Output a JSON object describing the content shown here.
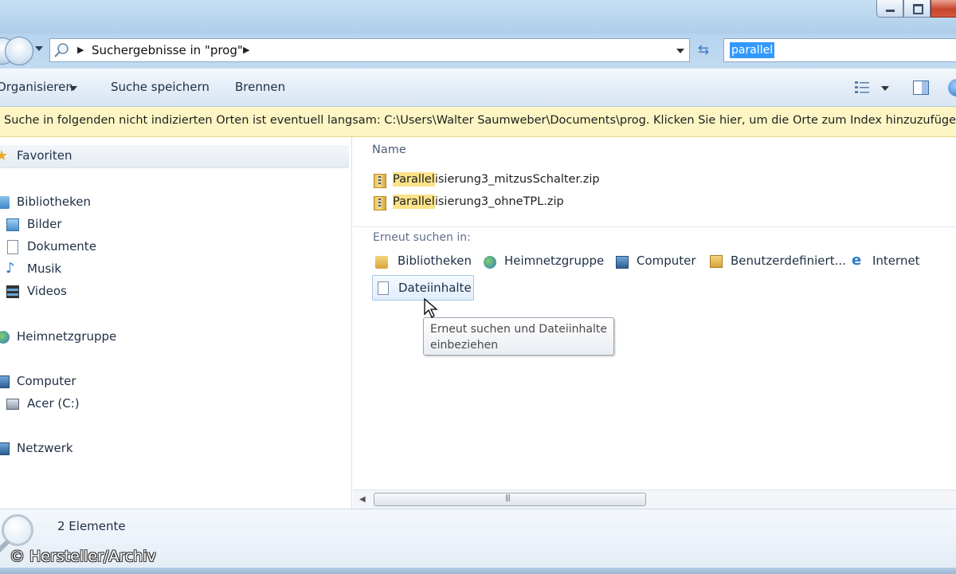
{
  "address": {
    "location": "Suchergebnisse in \"prog\""
  },
  "search": {
    "value": "parallel"
  },
  "toolbar": {
    "organize": "Organisieren",
    "save_search": "Suche speichern",
    "burn": "Brennen"
  },
  "infobar": {
    "text": "Suche in folgenden nicht indizierten Orten ist eventuell langsam: C:\\Users\\Walter Saumweber\\Documents\\prog. Klicken Sie hier, um die Orte zum Index hinzuzufügen..."
  },
  "navpane": {
    "favorites": "Favoriten",
    "libraries": "Bibliotheken",
    "library_items": [
      "Bilder",
      "Dokumente",
      "Musik",
      "Videos"
    ],
    "homegroup": "Heimnetzgruppe",
    "computer": "Computer",
    "drive": "Acer (C:)",
    "network": "Netzwerk"
  },
  "content": {
    "column_name": "Name",
    "files": [
      {
        "highlight": "Parallel",
        "rest": "isierung3_mitzusSchalter.zip"
      },
      {
        "highlight": "Parallel",
        "rest": "isierung3_ohneTPL.zip"
      }
    ],
    "search_again_label": "Erneut suchen in:",
    "search_again": [
      "Bibliotheken",
      "Heimnetzgruppe",
      "Computer",
      "Benutzerdefiniert...",
      "Internet"
    ],
    "file_contents_button": "Dateiinhalte",
    "tooltip": "Erneut suchen und Dateiinhalte einbeziehen"
  },
  "status": {
    "count": "2 Elemente"
  },
  "overlay": {
    "copyright": "© Hersteller/Archiv"
  },
  "colors": {
    "titlebar": "#b9d5ee",
    "infobar": "#fdf6c4",
    "highlight": "#fbe38a",
    "selection": "#3399ff"
  }
}
